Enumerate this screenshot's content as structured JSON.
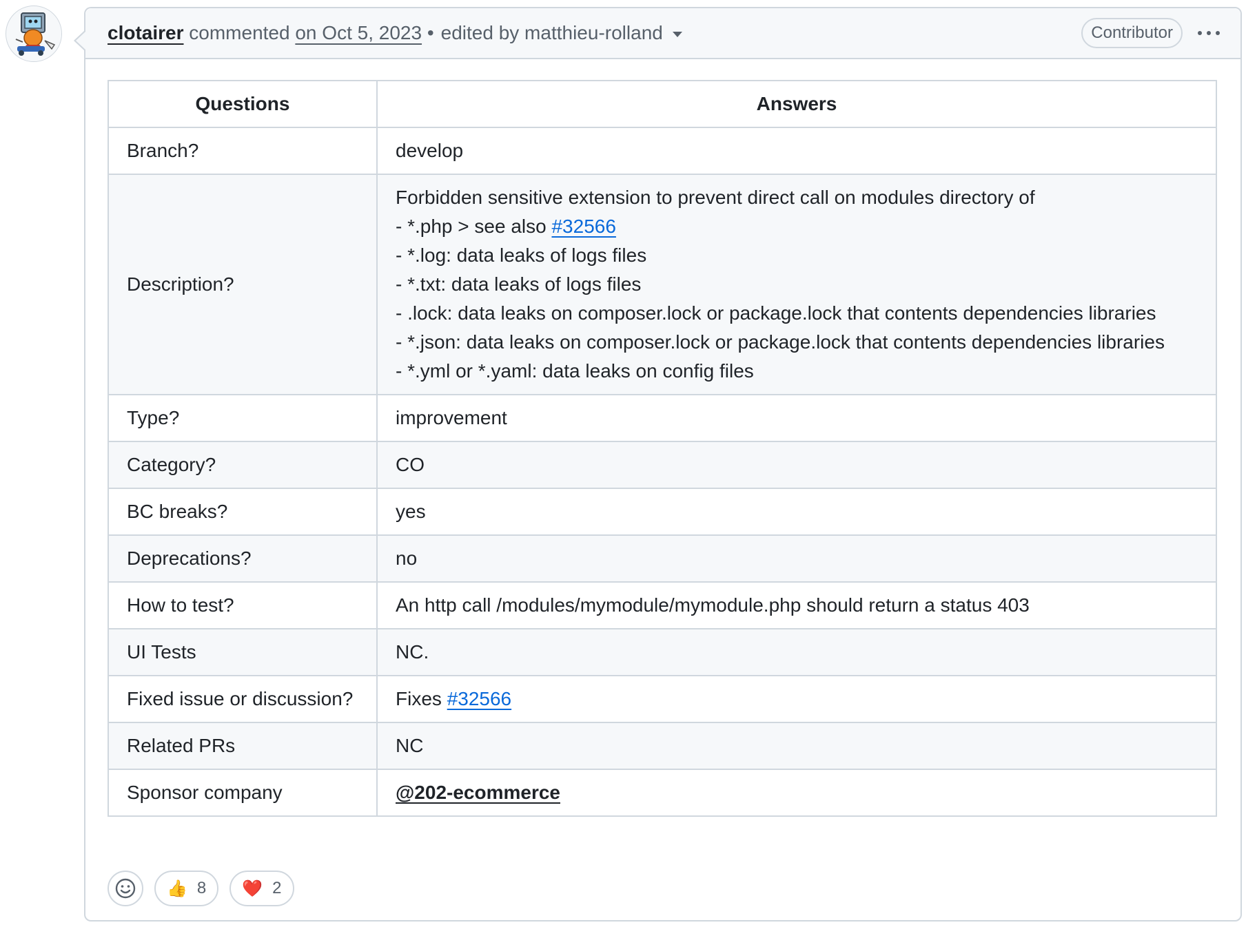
{
  "comment": {
    "author": "clotairer",
    "action": "commented",
    "date": "on Oct 5, 2023",
    "separator": "•",
    "edited_by": "edited by matthieu-rolland",
    "role_badge": "Contributor"
  },
  "table": {
    "headers": [
      "Questions",
      "Answers"
    ],
    "rows": [
      {
        "q": "Branch?",
        "a": "develop"
      },
      {
        "q": "Description?",
        "lines": [
          {
            "text": "Forbidden sensitive extension to prevent direct call on modules directory of"
          },
          {
            "text": "- *.php > see also ",
            "link": "#32566"
          },
          {
            "text": "- *.log: data leaks of logs files"
          },
          {
            "text": "- *.txt: data leaks of logs files"
          },
          {
            "text": "- .lock: data leaks on composer.lock or package.lock that contents dependencies libraries"
          },
          {
            "text": "- *.json: data leaks on composer.lock or package.lock that contents dependencies libraries"
          },
          {
            "text": "- *.yml or *.yaml: data leaks on config files"
          }
        ]
      },
      {
        "q": "Type?",
        "a": "improvement"
      },
      {
        "q": "Category?",
        "a": "CO"
      },
      {
        "q": "BC breaks?",
        "a": "yes"
      },
      {
        "q": "Deprecations?",
        "a": "no"
      },
      {
        "q": "How to test?",
        "a": "An http call /modules/mymodule/mymodule.php should return a status 403"
      },
      {
        "q": "UI Tests",
        "a": "NC."
      },
      {
        "q": "Fixed issue or discussion?",
        "a_prefix": "Fixes ",
        "a_link": "#32566"
      },
      {
        "q": "Related PRs",
        "a": "NC"
      },
      {
        "q": "Sponsor company",
        "a_mention": "@202-ecommerce"
      }
    ]
  },
  "reactions": {
    "add_icon": "smiley-icon",
    "thumbs_up": {
      "emoji": "👍",
      "count": "8"
    },
    "heart": {
      "emoji": "❤️",
      "count": "2"
    }
  },
  "colors": {
    "link": "#0969da",
    "border": "#d0d7de",
    "header_bg": "#f6f8fa",
    "muted": "#57606a"
  }
}
